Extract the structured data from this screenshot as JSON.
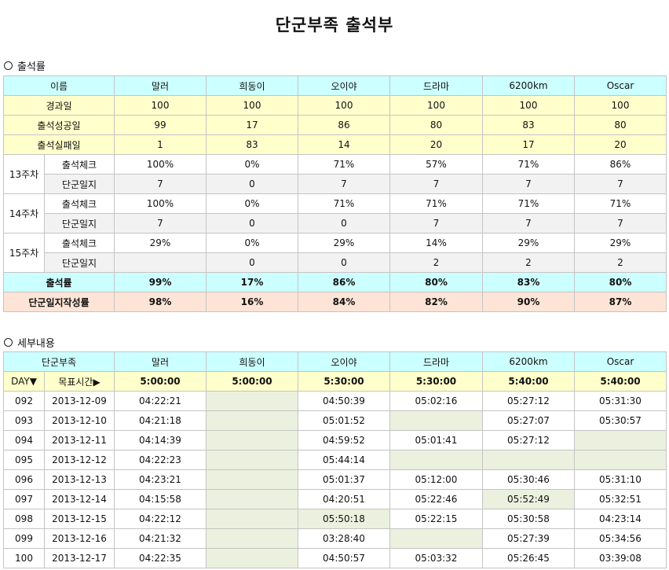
{
  "title": "단군부족 출석부",
  "section1": "출석률",
  "section2": "세부내용",
  "members": [
    "말러",
    "희동이",
    "오이야",
    "드라마",
    "6200km",
    "Oscar"
  ],
  "summary": {
    "header_label": "이름",
    "rows": [
      {
        "label": "경과일",
        "values": [
          "100",
          "100",
          "100",
          "100",
          "100",
          "100"
        ]
      },
      {
        "label": "출석성공일",
        "values": [
          "99",
          "17",
          "86",
          "80",
          "83",
          "80"
        ]
      },
      {
        "label": "출석실패일",
        "values": [
          "1",
          "83",
          "14",
          "20",
          "17",
          "20"
        ]
      }
    ],
    "weeks": [
      {
        "label": "13주차",
        "check_label": "출석체크",
        "check": [
          "100%",
          "0%",
          "71%",
          "57%",
          "71%",
          "86%"
        ],
        "diary_label": "단군일지",
        "diary": [
          "7",
          "0",
          "7",
          "7",
          "7",
          "7"
        ]
      },
      {
        "label": "14주차",
        "check_label": "출석체크",
        "check": [
          "100%",
          "0%",
          "71%",
          "71%",
          "71%",
          "71%"
        ],
        "diary_label": "단군일지",
        "diary": [
          "7",
          "0",
          "0",
          "7",
          "7",
          "7"
        ]
      },
      {
        "label": "15주차",
        "check_label": "출석체크",
        "check": [
          "29%",
          "0%",
          "29%",
          "14%",
          "29%",
          "29%"
        ],
        "diary_label": "단군일지",
        "diary": [
          "",
          "0",
          "0",
          "2",
          "2",
          "2"
        ]
      }
    ],
    "rate_label": "출석률",
    "rate": [
      "99%",
      "17%",
      "86%",
      "80%",
      "83%",
      "80%"
    ],
    "diary_rate_label": "단군일지작성률",
    "diary_rate": [
      "98%",
      "16%",
      "84%",
      "82%",
      "90%",
      "87%"
    ]
  },
  "detail": {
    "header_label": "단군부족",
    "day_label": "DAY▼",
    "target_label": "목표시간▶",
    "targets": [
      "5:00:00",
      "5:00:00",
      "5:30:00",
      "5:30:00",
      "5:40:00",
      "5:40:00"
    ],
    "rows": [
      {
        "day": "092",
        "date": "2013-12-09",
        "times": [
          "04:22:21",
          "",
          "04:50:39",
          "05:02:16",
          "05:27:12",
          "05:31:30"
        ]
      },
      {
        "day": "093",
        "date": "2013-12-10",
        "times": [
          "04:21:18",
          "",
          "05:01:52",
          "",
          "05:27:07",
          "05:30:57"
        ]
      },
      {
        "day": "094",
        "date": "2013-12-11",
        "times": [
          "04:14:39",
          "",
          "04:59:52",
          "05:01:41",
          "05:27:12",
          ""
        ]
      },
      {
        "day": "095",
        "date": "2013-12-12",
        "times": [
          "04:22:23",
          "",
          "05:44:14",
          "",
          "",
          ""
        ]
      },
      {
        "day": "096",
        "date": "2013-12-13",
        "times": [
          "04:23:21",
          "",
          "05:01:37",
          "05:12:00",
          "05:30:46",
          "05:31:10"
        ]
      },
      {
        "day": "097",
        "date": "2013-12-14",
        "times": [
          "04:15:58",
          "",
          "04:20:51",
          "05:22:46",
          "05:52:49",
          "05:32:51"
        ]
      },
      {
        "day": "098",
        "date": "2013-12-15",
        "times": [
          "04:22:12",
          "",
          "05:50:18",
          "05:22:15",
          "05:30:58",
          "04:23:14"
        ]
      },
      {
        "day": "099",
        "date": "2013-12-16",
        "times": [
          "04:21:32",
          "",
          "03:28:40",
          "",
          "05:27:39",
          "05:34:56"
        ]
      },
      {
        "day": "100",
        "date": "2013-12-17",
        "times": [
          "04:22:35",
          "",
          "04:50:57",
          "05:03:32",
          "05:26:45",
          "03:39:08"
        ]
      }
    ],
    "missed_cells": [
      [
        1
      ],
      [
        1,
        3
      ],
      [
        1,
        5
      ],
      [
        1,
        3,
        4,
        5
      ],
      [
        1
      ],
      [
        1,
        4
      ],
      [
        1,
        2
      ],
      [
        1,
        3
      ],
      [
        1
      ]
    ],
    "missed_color": "#ebf1de"
  }
}
